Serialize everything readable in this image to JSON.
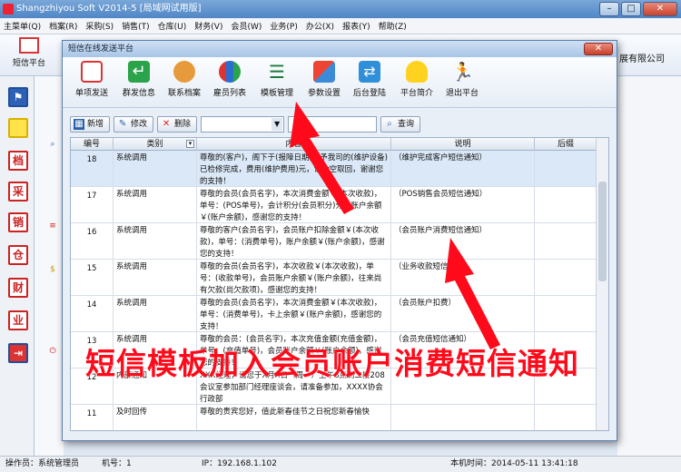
{
  "app": {
    "title": "Shangzhiyou Soft V2014-5 [局域网试用版]",
    "company_fragment": "展有限公司"
  },
  "menu": [
    "主菜单(Q)",
    "档案(R)",
    "采购(S)",
    "销售(T)",
    "仓库(U)",
    "财务(V)",
    "会员(W)",
    "业务(P)",
    "办公(X)",
    "报表(Y)",
    "帮助(Z)"
  ],
  "main_toolbar": {
    "sms_label": "短信平台"
  },
  "leftbar": [
    "档",
    "采",
    "销",
    "仓",
    "财",
    "业"
  ],
  "dialog": {
    "title": "短信在线发送平台",
    "close": "✕",
    "toolbar": [
      "单项发送",
      "群发信息",
      "联系档案",
      "雇员列表",
      "模板管理",
      "参数设置",
      "后台登陆",
      "平台简介",
      "退出平台"
    ],
    "actions": {
      "add": "新增",
      "edit": "修改",
      "delete": "删除",
      "query": "查询"
    },
    "grid": {
      "headers": [
        "编号",
        "类别",
        "内容",
        "说明",
        "后缀"
      ],
      "rows": [
        {
          "no": "18",
          "cat": "系统调用",
          "content": "尊敬的(客户)，阁下于(报障日期)交予我司的(维护设备)已检修完成，费用(维护费用)元，请抽空取回，谢谢您的支持！",
          "desc": "（维护完成客户短信通知）"
        },
        {
          "no": "17",
          "cat": "系统调用",
          "content": "尊敬的会员(会员名字)，本次消费金额￥(本次收款)，单号：(POS单号)，会计积分(会员积分)分，账户余额￥(账户余额)，感谢您的支持！",
          "desc": "（POS销售会员短信通知）"
        },
        {
          "no": "16",
          "cat": "系统调用",
          "content": "尊敬的客户(会员名字)，会员账户扣除金额￥(本次收款)，单号：(消费单号)，账户余额￥(账户余额)，感谢您的支持！",
          "desc": "（会员账户消费短信通知）"
        },
        {
          "no": "15",
          "cat": "系统调用",
          "content": "尊敬的会员(会员名字)，本次收款￥(本次收款)，单号：(收款单号)，会员账户余额￥(账户余额)，往来尚有欠款(尚欠款项)，感谢您的支持！",
          "desc": "（业务收款短信通知）"
        },
        {
          "no": "14",
          "cat": "系统调用",
          "content": "尊敬的会员(会员名字)，本次消费金额￥(本次收款)，单号：(消费单号)，卡上余额￥(账户余额)，感谢您的支持！",
          "desc": "（会员账户扣费）"
        },
        {
          "no": "13",
          "cat": "系统调用",
          "content": "尊敬的会员：(会员名字)，本次充值金额(充值金额)，单号：(充值单号)，会员账户余额￥(账户余额)，感谢您的支持！",
          "desc": "（会员充值短信通知）"
        },
        {
          "no": "12",
          "cat": "内部通知",
          "content": "XXX经理，请您于X月X日（周一）上午8点到二楼208会议室参加部门经理座谈会，请准备参加，XXXX协会行政部",
          "desc": ""
        },
        {
          "no": "11",
          "cat": "及时回传",
          "content": "尊敬的贵宾您好，值此新春佳节之日祝您新春愉快",
          "desc": ""
        }
      ]
    }
  },
  "caption": "短信模板加入会员账户消费短信通知",
  "status": {
    "operator": "操作员：系统管理员",
    "machine": "机号：1",
    "ip": "IP：192.168.1.102",
    "time": "本机时间：2014-05-11 13:41:18"
  },
  "colors": {
    "accent_red": "#ff0a1a",
    "title_blue": "#4f86c6"
  }
}
